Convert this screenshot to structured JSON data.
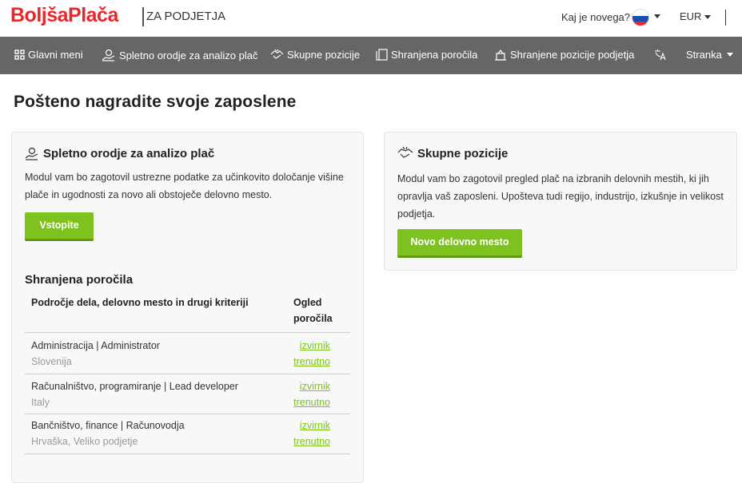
{
  "header": {
    "logo": "BoljšaPlača",
    "logo_sub": "ZA PODJETJA",
    "news_link": "Kaj je novega?",
    "currency": "EUR"
  },
  "nav": {
    "items": [
      {
        "label": "Glavni meni",
        "icon": "grid-icon"
      },
      {
        "label": "Spletno orodje za analizo plač",
        "icon": "hand-coin-icon"
      },
      {
        "label": "Skupne pozicije",
        "icon": "handshake-icon"
      },
      {
        "label": "Shranjena poročila",
        "icon": "documents-icon"
      },
      {
        "label": "Shranjene pozicije podjetja",
        "icon": "building-icon"
      },
      {
        "label": "Stranka",
        "icon": "translate-icon"
      }
    ]
  },
  "page": {
    "title": "Pošteno nagradite svoje zaposlene"
  },
  "card_left": {
    "title": "Spletno orodje za analizo plač",
    "text_line1": "Modul vam bo zagotovil ustrezne podatke za učinkovito določanje višine",
    "text_line2": "plače in ugodnosti za novo ali obstoječe delovno mesto.",
    "button": "Vstopite"
  },
  "reports": {
    "title": "Shranjena poročila",
    "col1": "Področje dela, delovno mesto in drugi kriteriji",
    "col2_line1": "Ogled",
    "col2_line2": "poročila",
    "rows": [
      {
        "title": "Administracija | Administrator",
        "sub": "Slovenija",
        "link1": "izvirnik",
        "link2": "trenutno"
      },
      {
        "title": "Računalništvo, programiranje | Lead developer",
        "sub": "Italy",
        "link1": "izvirnik",
        "link2": "trenutno"
      },
      {
        "title": "Bančništvo, finance | Računovodja",
        "sub": "Hrvaška, Veliko podjetje",
        "link1": "izvirnik",
        "link2": "trenutno"
      }
    ]
  },
  "card_right": {
    "title": "Skupne pozicije",
    "text_line1": "Modul vam bo zagotovil pregled plač na izbranih delovnih mestih, ki jih",
    "text_line2": "opravlja vaš zaposleni. Upošteva tudi regijo, industrijo, izkušnje in velikost",
    "text_line3": "podjetja.",
    "button": "Novo delovno mesto"
  },
  "colors": {
    "brand": "#e8262c",
    "nav_bg": "#666666",
    "accent": "#7dc21f"
  }
}
